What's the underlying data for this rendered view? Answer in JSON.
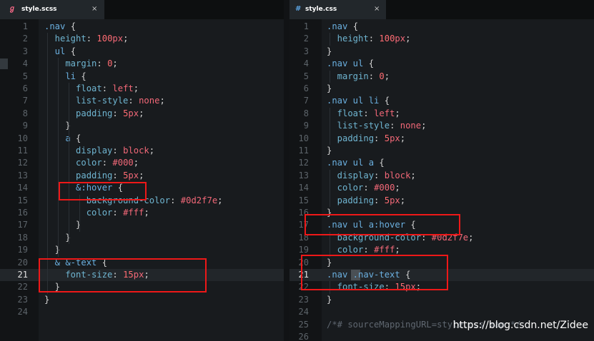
{
  "tabs": {
    "left": {
      "icon": "sass-icon",
      "icon_glyph": "ℊ",
      "label": "style.scss",
      "close": "×",
      "accent": "#ff6b8a"
    },
    "right": {
      "icon": "css-hash-icon",
      "icon_glyph": "#",
      "label": "style.css",
      "close": "×",
      "accent": "#5da8e8"
    }
  },
  "left_editor": {
    "language": "scss",
    "active_line": 21,
    "line_numbers": [
      "1",
      "2",
      "3",
      "4",
      "5",
      "6",
      "7",
      "8",
      "9",
      "10",
      "11",
      "12",
      "13",
      "14",
      "15",
      "16",
      "17",
      "18",
      "19",
      "20",
      "21",
      "22",
      "23",
      "24"
    ],
    "lines": [
      [
        {
          "t": ".nav",
          "c": "k"
        },
        {
          "t": " {",
          "c": "plain"
        }
      ],
      [
        {
          "t": "  height",
          "c": "p"
        },
        {
          "t": ": ",
          "c": "plain"
        },
        {
          "t": "100",
          "c": "n"
        },
        {
          "t": "px",
          "c": "v"
        },
        {
          "t": ";",
          "c": "plain"
        }
      ],
      [
        {
          "t": "  ul",
          "c": "k"
        },
        {
          "t": " {",
          "c": "plain"
        }
      ],
      [
        {
          "t": "    margin",
          "c": "p"
        },
        {
          "t": ": ",
          "c": "plain"
        },
        {
          "t": "0",
          "c": "n"
        },
        {
          "t": ";",
          "c": "plain"
        }
      ],
      [
        {
          "t": "    li",
          "c": "k"
        },
        {
          "t": " {",
          "c": "plain"
        }
      ],
      [
        {
          "t": "      float",
          "c": "p"
        },
        {
          "t": ": ",
          "c": "plain"
        },
        {
          "t": "left",
          "c": "v"
        },
        {
          "t": ";",
          "c": "plain"
        }
      ],
      [
        {
          "t": "      list-style",
          "c": "p"
        },
        {
          "t": ": ",
          "c": "plain"
        },
        {
          "t": "none",
          "c": "v"
        },
        {
          "t": ";",
          "c": "plain"
        }
      ],
      [
        {
          "t": "      padding",
          "c": "p"
        },
        {
          "t": ": ",
          "c": "plain"
        },
        {
          "t": "5",
          "c": "n"
        },
        {
          "t": "px",
          "c": "v"
        },
        {
          "t": ";",
          "c": "plain"
        }
      ],
      [
        {
          "t": "    }",
          "c": "plain"
        }
      ],
      [
        {
          "t": "    a",
          "c": "k"
        },
        {
          "t": " {",
          "c": "plain"
        }
      ],
      [
        {
          "t": "      display",
          "c": "p"
        },
        {
          "t": ": ",
          "c": "plain"
        },
        {
          "t": "block",
          "c": "v"
        },
        {
          "t": ";",
          "c": "plain"
        }
      ],
      [
        {
          "t": "      color",
          "c": "p"
        },
        {
          "t": ": ",
          "c": "plain"
        },
        {
          "t": "#000",
          "c": "v"
        },
        {
          "t": ";",
          "c": "plain"
        }
      ],
      [
        {
          "t": "      padding",
          "c": "p"
        },
        {
          "t": ": ",
          "c": "plain"
        },
        {
          "t": "5",
          "c": "n"
        },
        {
          "t": "px",
          "c": "v"
        },
        {
          "t": ";",
          "c": "plain"
        }
      ],
      [
        {
          "t": "      &:hover",
          "c": "k"
        },
        {
          "t": " {",
          "c": "plain"
        }
      ],
      [
        {
          "t": "        background-color",
          "c": "p"
        },
        {
          "t": ": ",
          "c": "plain"
        },
        {
          "t": "#0d2f7e",
          "c": "v"
        },
        {
          "t": ";",
          "c": "plain"
        }
      ],
      [
        {
          "t": "        color",
          "c": "p"
        },
        {
          "t": ": ",
          "c": "plain"
        },
        {
          "t": "#fff",
          "c": "v"
        },
        {
          "t": ";",
          "c": "plain"
        }
      ],
      [
        {
          "t": "      }",
          "c": "plain"
        }
      ],
      [
        {
          "t": "    }",
          "c": "plain"
        }
      ],
      [
        {
          "t": "  }",
          "c": "plain"
        }
      ],
      [
        {
          "t": "  & &-text",
          "c": "k"
        },
        {
          "t": " {",
          "c": "plain"
        }
      ],
      [
        {
          "t": "    font-size",
          "c": "p"
        },
        {
          "t": ": ",
          "c": "plain"
        },
        {
          "t": "15",
          "c": "n"
        },
        {
          "t": "px",
          "c": "v"
        },
        {
          "t": ";",
          "c": "plain"
        }
      ],
      [
        {
          "t": "  }",
          "c": "plain"
        }
      ],
      [
        {
          "t": "}",
          "c": "plain"
        }
      ],
      []
    ]
  },
  "right_editor": {
    "language": "css",
    "active_line": 21,
    "line_numbers": [
      "1",
      "2",
      "3",
      "4",
      "5",
      "6",
      "7",
      "8",
      "9",
      "10",
      "11",
      "12",
      "13",
      "14",
      "15",
      "16",
      "17",
      "18",
      "19",
      "20",
      "21",
      "22",
      "23",
      "24",
      "25",
      "26"
    ],
    "lines": [
      [
        {
          "t": ".nav",
          "c": "k"
        },
        {
          "t": " {",
          "c": "plain"
        }
      ],
      [
        {
          "t": "  height",
          "c": "p"
        },
        {
          "t": ": ",
          "c": "plain"
        },
        {
          "t": "100",
          "c": "n"
        },
        {
          "t": "px",
          "c": "v"
        },
        {
          "t": ";",
          "c": "plain"
        }
      ],
      [
        {
          "t": "}",
          "c": "plain"
        }
      ],
      [
        {
          "t": ".nav ul",
          "c": "k"
        },
        {
          "t": " {",
          "c": "plain"
        }
      ],
      [
        {
          "t": "  margin",
          "c": "p"
        },
        {
          "t": ": ",
          "c": "plain"
        },
        {
          "t": "0",
          "c": "n"
        },
        {
          "t": ";",
          "c": "plain"
        }
      ],
      [
        {
          "t": "}",
          "c": "plain"
        }
      ],
      [
        {
          "t": ".nav ul li",
          "c": "k"
        },
        {
          "t": " {",
          "c": "plain"
        }
      ],
      [
        {
          "t": "  float",
          "c": "p"
        },
        {
          "t": ": ",
          "c": "plain"
        },
        {
          "t": "left",
          "c": "v"
        },
        {
          "t": ";",
          "c": "plain"
        }
      ],
      [
        {
          "t": "  list-style",
          "c": "p"
        },
        {
          "t": ": ",
          "c": "plain"
        },
        {
          "t": "none",
          "c": "v"
        },
        {
          "t": ";",
          "c": "plain"
        }
      ],
      [
        {
          "t": "  padding",
          "c": "p"
        },
        {
          "t": ": ",
          "c": "plain"
        },
        {
          "t": "5",
          "c": "n"
        },
        {
          "t": "px",
          "c": "v"
        },
        {
          "t": ";",
          "c": "plain"
        }
      ],
      [
        {
          "t": "}",
          "c": "plain"
        }
      ],
      [
        {
          "t": ".nav ul a",
          "c": "k"
        },
        {
          "t": " {",
          "c": "plain"
        }
      ],
      [
        {
          "t": "  display",
          "c": "p"
        },
        {
          "t": ": ",
          "c": "plain"
        },
        {
          "t": "block",
          "c": "v"
        },
        {
          "t": ";",
          "c": "plain"
        }
      ],
      [
        {
          "t": "  color",
          "c": "p"
        },
        {
          "t": ": ",
          "c": "plain"
        },
        {
          "t": "#000",
          "c": "v"
        },
        {
          "t": ";",
          "c": "plain"
        }
      ],
      [
        {
          "t": "  padding",
          "c": "p"
        },
        {
          "t": ": ",
          "c": "plain"
        },
        {
          "t": "5",
          "c": "n"
        },
        {
          "t": "px",
          "c": "v"
        },
        {
          "t": ";",
          "c": "plain"
        }
      ],
      [
        {
          "t": "}",
          "c": "plain"
        }
      ],
      [
        {
          "t": ".nav ul a:hover",
          "c": "k"
        },
        {
          "t": " {",
          "c": "plain"
        }
      ],
      [
        {
          "t": "  background-color",
          "c": "p"
        },
        {
          "t": ": ",
          "c": "plain"
        },
        {
          "t": "#0d2f7e",
          "c": "v"
        },
        {
          "t": ";",
          "c": "plain"
        }
      ],
      [
        {
          "t": "  color",
          "c": "p"
        },
        {
          "t": ": ",
          "c": "plain"
        },
        {
          "t": "#fff",
          "c": "v"
        },
        {
          "t": ";",
          "c": "plain"
        }
      ],
      [
        {
          "t": "}",
          "c": "plain"
        }
      ],
      [
        {
          "t": ".nav .nav-text",
          "c": "k"
        },
        {
          "t": " {",
          "c": "plain"
        }
      ],
      [
        {
          "t": "  font-size",
          "c": "p"
        },
        {
          "t": ": ",
          "c": "plain"
        },
        {
          "t": "15",
          "c": "n"
        },
        {
          "t": "px",
          "c": "v"
        },
        {
          "t": ";",
          "c": "plain"
        }
      ],
      [
        {
          "t": "}",
          "c": "plain"
        }
      ],
      [],
      [
        {
          "t": "/*# sourceMappingURL=style.css.map */",
          "c": "c"
        }
      ],
      []
    ]
  },
  "highlights": {
    "color": "#ee1818",
    "left": [
      "hover-block",
      "text-block"
    ],
    "right": [
      "hover-block",
      "text-block"
    ]
  },
  "watermark": "https://blog.csdn.net/Zidee"
}
